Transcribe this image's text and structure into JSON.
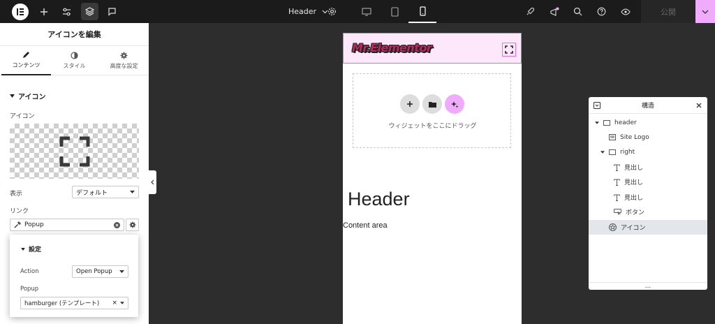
{
  "topbar": {
    "template_name": "Header",
    "publish_label": "公開",
    "accent_color": "#f0abfc"
  },
  "panel": {
    "title": "アイコンを編集",
    "tabs": [
      {
        "label": "コンテンツ",
        "icon": "pencil-icon"
      },
      {
        "label": "スタイル",
        "icon": "half-circle-icon"
      },
      {
        "label": "高度な設定",
        "icon": "gear-icon"
      }
    ],
    "section_title": "アイコン",
    "icon_label": "アイコン",
    "preview_icon": "expand-icon",
    "display_label": "表示",
    "display_value": "デフォルト",
    "link_label": "リンク",
    "link_value": "Popup",
    "popover": {
      "title": "設定",
      "action_label": "Action",
      "action_value": "Open Popup",
      "popup_label": "Popup",
      "popup_value": "hamburger (テンプレート)"
    }
  },
  "preview": {
    "site_logo": "Mr.Elementor",
    "drop_text": "ウィジェットをここにドラッグ",
    "heading": "Header",
    "content": "Content area"
  },
  "structure": {
    "title": "構造",
    "nodes": [
      {
        "label": "header",
        "icon": "container-icon"
      },
      {
        "label": "Site Logo",
        "icon": "site-logo-icon"
      },
      {
        "label": "right",
        "icon": "container-icon"
      },
      {
        "label": "見出し",
        "icon": "heading-icon"
      },
      {
        "label": "見出し",
        "icon": "heading-icon"
      },
      {
        "label": "見出し",
        "icon": "heading-icon"
      },
      {
        "label": "ボタン",
        "icon": "button-icon"
      },
      {
        "label": "アイコン",
        "icon": "star-icon"
      }
    ],
    "footer": "..."
  }
}
